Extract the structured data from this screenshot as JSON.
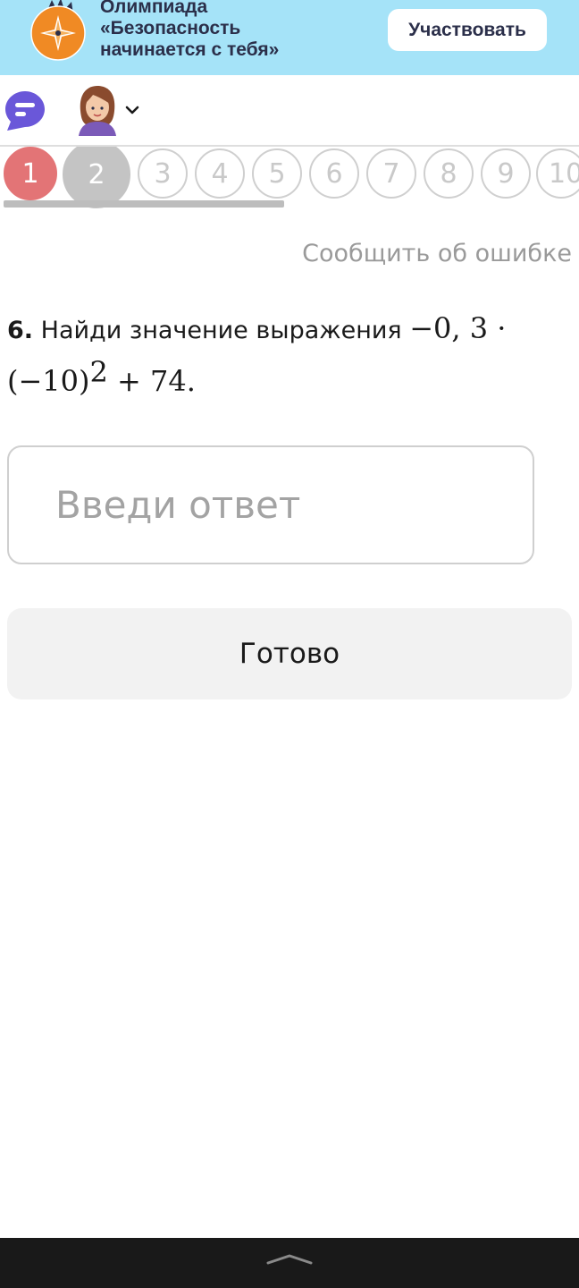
{
  "banner": {
    "title_lines": [
      "Олимпиада",
      "«Безопасность",
      "начинается с тебя»"
    ],
    "participate_label": "Участвовать",
    "logo_icon": "compass-emblem-icon",
    "background": "#a5e3f8"
  },
  "header": {
    "chat_icon": "chat-bubble-icon",
    "avatar_icon": "user-avatar-icon",
    "dropdown_icon": "chevron-down-icon"
  },
  "questions": {
    "items": [
      "1",
      "2",
      "3",
      "4",
      "5",
      "6",
      "7",
      "8",
      "9",
      "10"
    ],
    "states": [
      "answered",
      "current",
      "",
      "",
      "",
      "",
      "",
      "",
      "",
      ""
    ]
  },
  "report_label": "Сообщить об ошибке",
  "question": {
    "number": "6.",
    "text": "Найди значение выражения",
    "expr_part1": "−0, 3 ·",
    "expr_base": "(−10)",
    "expr_exp": "2",
    "expr_tail": " + 74."
  },
  "answer": {
    "placeholder": "Введи ответ",
    "value": ""
  },
  "done_label": "Готово",
  "colors": {
    "answered": "#e37476",
    "current": "#c4c4c4",
    "chat_accent": "#6a57d9"
  }
}
